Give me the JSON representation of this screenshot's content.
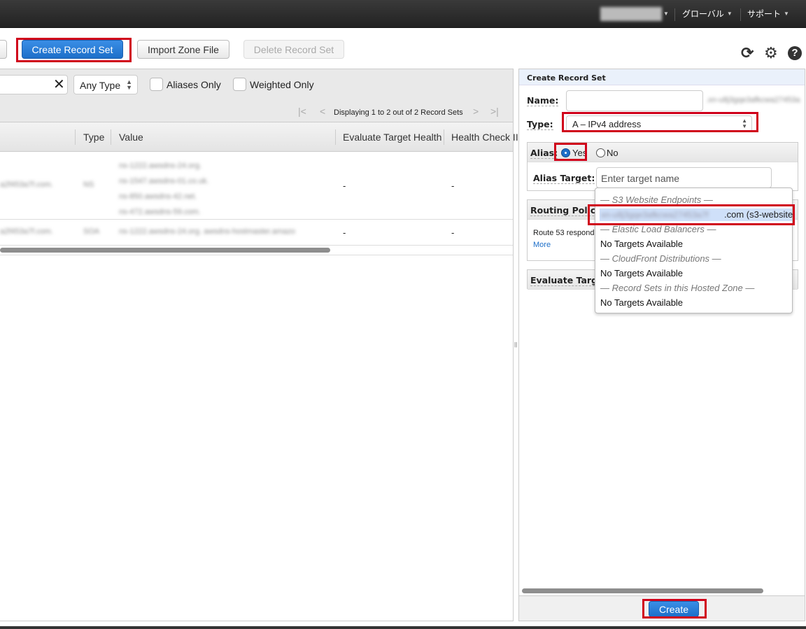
{
  "topbar": {
    "global": "グローバル",
    "support": "サポート"
  },
  "toolbar": {
    "create_record_set": "Create Record Set",
    "import_zone_file": "Import Zone File",
    "delete_record_set": "Delete Record Set"
  },
  "filter": {
    "type_select": "Any Type",
    "aliases_only": "Aliases Only",
    "weighted_only": "Weighted Only",
    "pagination": "Displaying 1 to 2 out of 2 Record Sets"
  },
  "table": {
    "columns": [
      "Type",
      "Value",
      "Evaluate Target Health",
      "Health Check II"
    ],
    "rows": [
      {
        "evaluate": "-",
        "health": "-"
      },
      {
        "evaluate": "-",
        "health": "-"
      }
    ]
  },
  "panel": {
    "title": "Create Record Set",
    "name_label": "Name:",
    "type_label": "Type:",
    "type_value": "A – IPv4 address",
    "alias_label": "Alias:",
    "alias_yes": "Yes",
    "alias_no": "No",
    "alias_selected": "Yes",
    "alias_target_label": "Alias Target:",
    "alias_target_placeholder": "Enter target name",
    "routing_label": "Routing Policy",
    "routing_text": "Route 53 responds",
    "more_link": "More",
    "evaluate_label": "Evaluate Target Health",
    "create_button": "Create"
  },
  "dropdown": {
    "groups": [
      {
        "title": "— S3 Website Endpoints —",
        "item": ".com (s3-website"
      },
      {
        "title": "— Elastic Load Balancers —",
        "item": "No Targets Available"
      },
      {
        "title": "— CloudFront Distributions —",
        "item": "No Targets Available"
      },
      {
        "title": "— Record Sets in this Hosted Zone —",
        "item": "No Targets Available"
      }
    ]
  },
  "colors": {
    "primary": "#1d6fc9",
    "highlight": "#d0021b",
    "selected_item": "#cfe0f9"
  }
}
